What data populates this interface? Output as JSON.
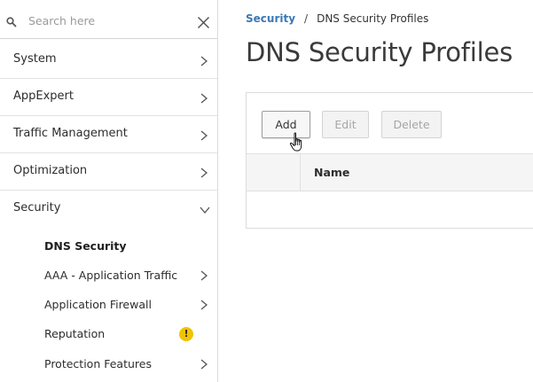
{
  "sidebar": {
    "search": {
      "placeholder": "Search here",
      "value": ""
    },
    "items": [
      {
        "label": "System",
        "expanded": false
      },
      {
        "label": "AppExpert",
        "expanded": false
      },
      {
        "label": "Traffic Management",
        "expanded": false
      },
      {
        "label": "Optimization",
        "expanded": false
      },
      {
        "label": "Security",
        "expanded": true
      }
    ],
    "security_children": [
      {
        "label": "DNS Security",
        "active": true,
        "has_chevron": false,
        "warning": false
      },
      {
        "label": "AAA - Application Traffic",
        "active": false,
        "has_chevron": true,
        "warning": false
      },
      {
        "label": "Application Firewall",
        "active": false,
        "has_chevron": true,
        "warning": false
      },
      {
        "label": "Reputation",
        "active": false,
        "has_chevron": false,
        "warning": true
      },
      {
        "label": "Protection Features",
        "active": false,
        "has_chevron": true,
        "warning": false
      }
    ],
    "warning_glyph": "!"
  },
  "breadcrumb": {
    "parent": "Security",
    "separator": "/",
    "current": "DNS Security Profiles"
  },
  "page": {
    "title": "DNS Security Profiles"
  },
  "toolbar": {
    "add_label": "Add",
    "edit_label": "Edit",
    "delete_label": "Delete",
    "edit_enabled": false,
    "delete_enabled": false
  },
  "table": {
    "columns": [
      "Name"
    ],
    "rows": []
  },
  "colors": {
    "link": "#3a78b5",
    "warning": "#f2c300",
    "disabled_text": "#a6a6a6"
  },
  "icons": {
    "search": "search-icon",
    "close": "close-icon",
    "chevron_right": "chevron-right-icon",
    "chevron_down": "chevron-down-icon",
    "cursor": "hand-pointer-icon"
  }
}
